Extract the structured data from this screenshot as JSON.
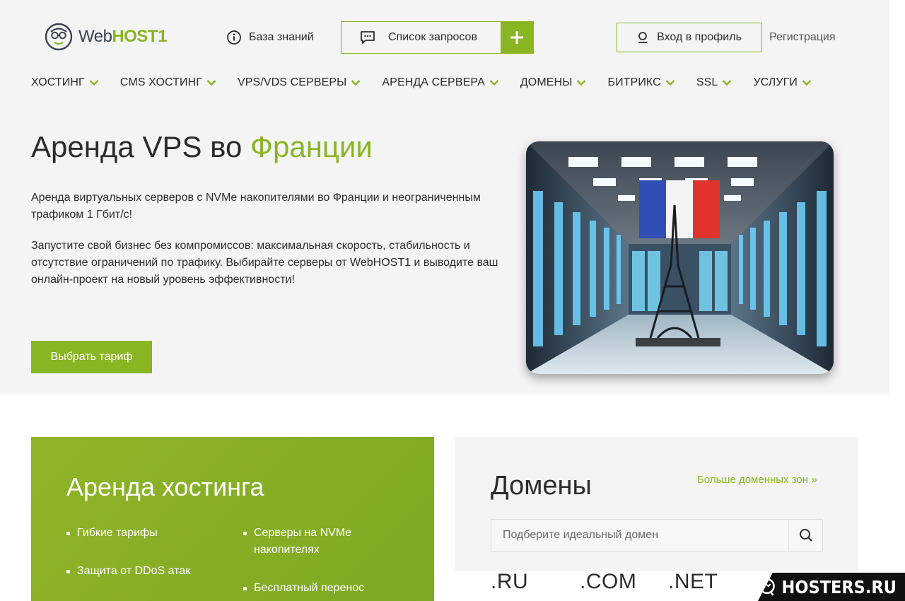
{
  "header": {
    "logo_web": "Web",
    "logo_host": "HOST1",
    "knowledge_base": "База знаний",
    "requests_list": "Список запросов",
    "login": "Вход в профиль",
    "register": "Регистрация"
  },
  "nav": {
    "items": [
      {
        "label": "ХОСТИНГ"
      },
      {
        "label": "CMS ХОСТИНГ"
      },
      {
        "label": "VPS/VDS СЕРВЕРЫ"
      },
      {
        "label": "АРЕНДА СЕРВЕРА"
      },
      {
        "label": "ДОМЕНЫ"
      },
      {
        "label": "БИТРИКС"
      },
      {
        "label": "SSL"
      },
      {
        "label": "УСЛУГИ"
      }
    ]
  },
  "hero": {
    "title_main": "Аренда VPS во ",
    "title_accent": "Франции",
    "paragraph1": "Аренда виртуальных серверов с NVMe накопителями во Франции и неограниченным трафиком 1 Гбит/с!",
    "paragraph2": "Запустите свой бизнес без компромиссов: максимальная скорость, стабильность и отсутствие ограничений по трафику. Выбирайте серверы от WebHOST1 и выводите ваш онлайн-проект на новый уровень эффективности!",
    "cta": "Выбрать тариф"
  },
  "hosting_card": {
    "title": "Аренда хостинга",
    "features": [
      "Гибкие тарифы",
      "Защита от DDoS атак",
      "Серверы на NVMe накопителях",
      "Бесплатный перенос"
    ]
  },
  "domains_card": {
    "title": "Домены",
    "more_link": "Больше доменных зон »",
    "search_placeholder": "Подберите идеальный домен",
    "zones": [
      ".RU",
      ".COM",
      ".NET"
    ]
  },
  "watermark": {
    "text": "HOSTERS.RU"
  },
  "colors": {
    "accent": "#8ab523",
    "page_bg": "#f4f4f4",
    "text": "#2b2b2b"
  },
  "icons": [
    "logo-mascot-icon",
    "info-icon",
    "chat-icon",
    "plus-icon",
    "user-icon",
    "chevron-down-icon",
    "search-icon",
    "hosters-logo-icon"
  ]
}
